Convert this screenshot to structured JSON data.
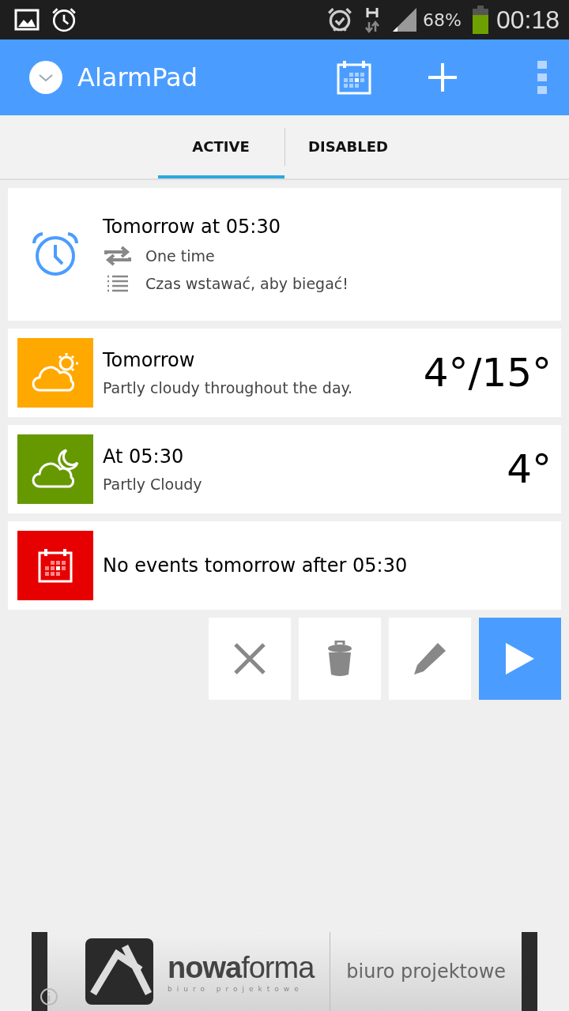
{
  "status_bar": {
    "battery": "68%",
    "time": "00:18"
  },
  "app_bar": {
    "title": "AlarmPad"
  },
  "tabs": [
    {
      "label": "ACTIVE",
      "selected": true
    },
    {
      "label": "DISABLED",
      "selected": false
    }
  ],
  "alarm": {
    "title": "Tomorrow at 05:30",
    "repeat": "One time",
    "note": "Czas wstawać, aby biegać!"
  },
  "info_cards": [
    {
      "kind": "weather_day",
      "color": "#ffa800",
      "title": "Tomorrow",
      "subtitle": "Partly cloudy throughout the day.",
      "temperature": "4°/15°"
    },
    {
      "kind": "weather_night",
      "color": "#669900",
      "title": "At 05:30",
      "subtitle": "Partly Cloudy",
      "temperature": "4°"
    },
    {
      "kind": "calendar",
      "color": "#e60000",
      "title": "No events tomorrow after 05:30"
    }
  ],
  "actions": [
    {
      "kind": "dismiss"
    },
    {
      "kind": "delete"
    },
    {
      "kind": "edit"
    },
    {
      "kind": "play"
    }
  ],
  "ad": {
    "brand": "**nowa**forma",
    "brand_caption": "biuro projektowe",
    "tagline": "biuro projektowe"
  }
}
